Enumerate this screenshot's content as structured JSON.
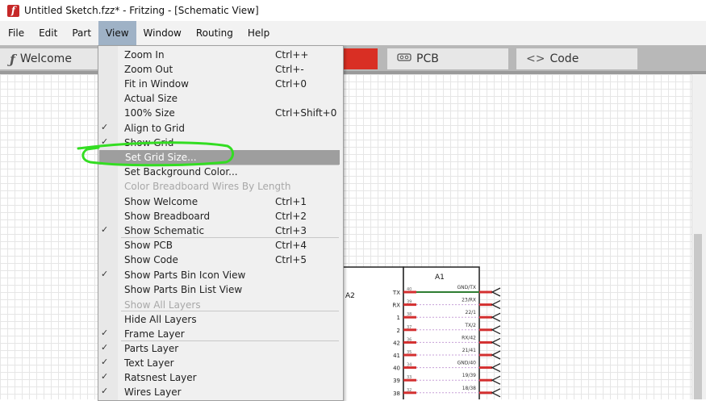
{
  "window": {
    "title": "Untitled Sketch.fzz* - Fritzing - [Schematic View]",
    "app_icon_glyph": "f"
  },
  "menubar": [
    "File",
    "Edit",
    "Part",
    "View",
    "Window",
    "Routing",
    "Help"
  ],
  "active_menu": "View",
  "tabs": {
    "welcome": "Welcome",
    "pcb": "PCB",
    "code": "Code"
  },
  "view_menu": {
    "items": [
      {
        "label": "Zoom In",
        "shortcut": "Ctrl++",
        "checked": false,
        "enabled": true
      },
      {
        "label": "Zoom Out",
        "shortcut": "Ctrl+-",
        "checked": false,
        "enabled": true
      },
      {
        "label": "Fit in Window",
        "shortcut": "Ctrl+0",
        "checked": false,
        "enabled": true
      },
      {
        "label": "Actual Size",
        "shortcut": "",
        "checked": false,
        "enabled": true
      },
      {
        "label": "100% Size",
        "shortcut": "Ctrl+Shift+0",
        "checked": false,
        "enabled": true
      },
      {
        "label": "Align to Grid",
        "shortcut": "",
        "checked": true,
        "enabled": true
      },
      {
        "label": "Show Grid",
        "shortcut": "",
        "checked": true,
        "enabled": true
      },
      {
        "label": "Set Grid Size...",
        "shortcut": "",
        "checked": false,
        "enabled": true,
        "highlighted": true
      },
      {
        "label": "Set Background Color...",
        "shortcut": "",
        "checked": false,
        "enabled": true
      },
      {
        "label": "Color Breadboard Wires By Length",
        "shortcut": "",
        "checked": false,
        "enabled": false
      },
      {
        "label": "Show Welcome",
        "shortcut": "Ctrl+1",
        "checked": false,
        "enabled": true
      },
      {
        "label": "Show Breadboard",
        "shortcut": "Ctrl+2",
        "checked": false,
        "enabled": true
      },
      {
        "label": "Show Schematic",
        "shortcut": "Ctrl+3",
        "checked": true,
        "enabled": true
      },
      {
        "label": "Show PCB",
        "shortcut": "Ctrl+4",
        "checked": false,
        "enabled": true
      },
      {
        "label": "Show Code",
        "shortcut": "Ctrl+5",
        "checked": false,
        "enabled": true
      },
      {
        "label": "Show Parts Bin Icon View",
        "shortcut": "",
        "checked": true,
        "enabled": true
      },
      {
        "label": "Show Parts Bin List View",
        "shortcut": "",
        "checked": false,
        "enabled": true
      },
      {
        "label": "Show All Layers",
        "shortcut": "",
        "checked": false,
        "enabled": false
      },
      {
        "label": "Hide All Layers",
        "shortcut": "",
        "checked": false,
        "enabled": true
      },
      {
        "label": "Frame Layer",
        "shortcut": "",
        "checked": true,
        "enabled": true
      },
      {
        "label": "Parts Layer",
        "shortcut": "",
        "checked": true,
        "enabled": true
      },
      {
        "label": "Text Layer",
        "shortcut": "",
        "checked": true,
        "enabled": true
      },
      {
        "label": "Ratsnest Layer",
        "shortcut": "",
        "checked": true,
        "enabled": true
      },
      {
        "label": "Wires Layer",
        "shortcut": "",
        "checked": true,
        "enabled": true
      }
    ]
  },
  "annotation": {
    "color": "#33dd22",
    "target": "Set Grid Size..."
  },
  "schematic": {
    "part_a1": "A1",
    "part_a2": "A2",
    "left_pins": [
      "TX",
      "RX",
      "1",
      "2",
      "42",
      "41",
      "40",
      "39",
      "38"
    ],
    "pin_numbers": [
      "40",
      "39",
      "38",
      "37",
      "36",
      "35",
      "34",
      "33",
      "32"
    ],
    "right_labels": [
      "GND/TX",
      "23/RX",
      "22/1",
      "TX/2",
      "RX/42",
      "21/41",
      "GND/40",
      "19/39",
      "18/38"
    ],
    "pin_color": "#d32f2f",
    "wire_color": "#2e7d32"
  }
}
